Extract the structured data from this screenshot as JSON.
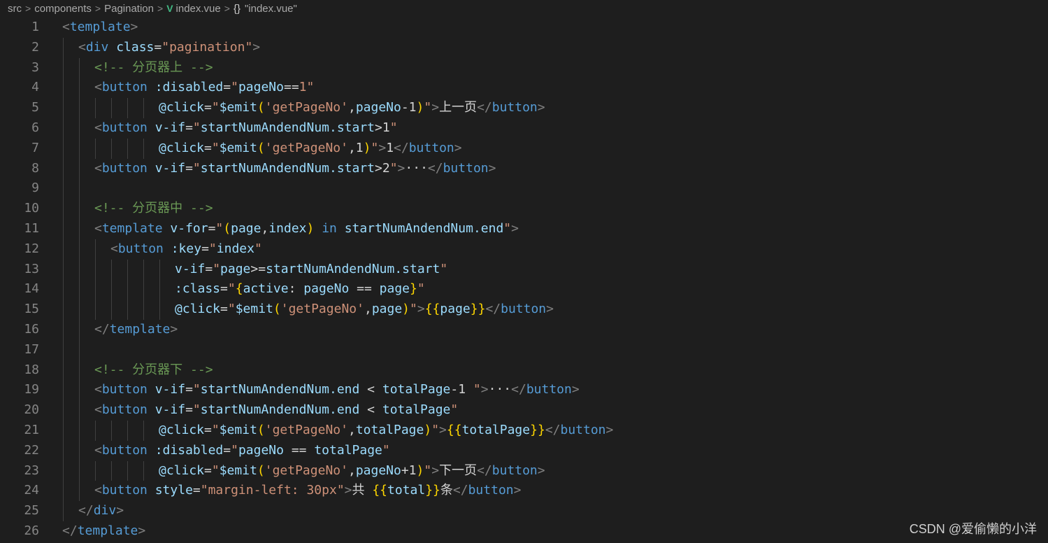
{
  "breadcrumb": {
    "items": [
      "src",
      "components",
      "Pagination",
      "index.vue",
      "\"index.vue\""
    ],
    "separator": ">",
    "braces": "{}"
  },
  "watermark": "CSDN @爱偷懒的小洋",
  "lines": [
    {
      "n": "1",
      "indent": 0,
      "guides": 0,
      "tokens": [
        [
          "punc",
          "<"
        ],
        [
          "tag",
          "template"
        ],
        [
          "punc",
          ">"
        ]
      ]
    },
    {
      "n": "2",
      "indent": 2,
      "guides": 1,
      "tokens": [
        [
          "punc",
          "<"
        ],
        [
          "tag",
          "div"
        ],
        [
          "text",
          " "
        ],
        [
          "attr",
          "class"
        ],
        [
          "text",
          "="
        ],
        [
          "str",
          "\"pagination\""
        ],
        [
          "punc",
          ">"
        ]
      ]
    },
    {
      "n": "3",
      "indent": 4,
      "guides": 2,
      "tokens": [
        [
          "com",
          "<!-- 分页器上 -->"
        ]
      ]
    },
    {
      "n": "4",
      "indent": 4,
      "guides": 2,
      "tokens": [
        [
          "punc",
          "<"
        ],
        [
          "tag",
          "button"
        ],
        [
          "text",
          " "
        ],
        [
          "attr",
          ":disabled"
        ],
        [
          "text",
          "="
        ],
        [
          "str",
          "\""
        ],
        [
          "attr",
          "pageNo"
        ],
        [
          "text",
          "=="
        ],
        [
          "str",
          "1\""
        ]
      ]
    },
    {
      "n": "5",
      "indent": 12,
      "guides": 6,
      "tokens": [
        [
          "attr",
          "@click"
        ],
        [
          "text",
          "="
        ],
        [
          "str",
          "\""
        ],
        [
          "attr",
          "$emit"
        ],
        [
          "paren",
          "("
        ],
        [
          "str",
          "'getPageNo'"
        ],
        [
          "text",
          ","
        ],
        [
          "attr",
          "pageNo"
        ],
        [
          "text",
          "-1"
        ],
        [
          "paren",
          ")"
        ],
        [
          "str",
          "\""
        ],
        [
          "punc",
          ">"
        ],
        [
          "text",
          "上一页"
        ],
        [
          "punc",
          "</"
        ],
        [
          "tag",
          "button"
        ],
        [
          "punc",
          ">"
        ]
      ]
    },
    {
      "n": "6",
      "indent": 4,
      "guides": 2,
      "tokens": [
        [
          "punc",
          "<"
        ],
        [
          "tag",
          "button"
        ],
        [
          "text",
          " "
        ],
        [
          "attr",
          "v-if"
        ],
        [
          "text",
          "="
        ],
        [
          "str",
          "\""
        ],
        [
          "attr",
          "startNumAndendNum.start"
        ],
        [
          "text",
          ">1"
        ],
        [
          "str",
          "\""
        ]
      ]
    },
    {
      "n": "7",
      "indent": 12,
      "guides": 6,
      "tokens": [
        [
          "attr",
          "@click"
        ],
        [
          "text",
          "="
        ],
        [
          "str",
          "\""
        ],
        [
          "attr",
          "$emit"
        ],
        [
          "paren",
          "("
        ],
        [
          "str",
          "'getPageNo'"
        ],
        [
          "text",
          ",1"
        ],
        [
          "paren",
          ")"
        ],
        [
          "str",
          "\""
        ],
        [
          "punc",
          ">"
        ],
        [
          "text",
          "1"
        ],
        [
          "punc",
          "</"
        ],
        [
          "tag",
          "button"
        ],
        [
          "punc",
          ">"
        ]
      ]
    },
    {
      "n": "8",
      "indent": 4,
      "guides": 2,
      "tokens": [
        [
          "punc",
          "<"
        ],
        [
          "tag",
          "button"
        ],
        [
          "text",
          " "
        ],
        [
          "attr",
          "v-if"
        ],
        [
          "text",
          "="
        ],
        [
          "str",
          "\""
        ],
        [
          "attr",
          "startNumAndendNum.start"
        ],
        [
          "text",
          ">2"
        ],
        [
          "str",
          "\""
        ],
        [
          "punc",
          ">"
        ],
        [
          "text",
          "···"
        ],
        [
          "punc",
          "</"
        ],
        [
          "tag",
          "button"
        ],
        [
          "punc",
          ">"
        ]
      ]
    },
    {
      "n": "9",
      "indent": 0,
      "guides": 2,
      "tokens": []
    },
    {
      "n": "10",
      "indent": 4,
      "guides": 2,
      "tokens": [
        [
          "com",
          "<!-- 分页器中 -->"
        ]
      ]
    },
    {
      "n": "11",
      "indent": 4,
      "guides": 2,
      "tokens": [
        [
          "punc",
          "<"
        ],
        [
          "tag",
          "template"
        ],
        [
          "text",
          " "
        ],
        [
          "attr",
          "v-for"
        ],
        [
          "text",
          "="
        ],
        [
          "str",
          "\""
        ],
        [
          "paren",
          "("
        ],
        [
          "attr",
          "page"
        ],
        [
          "text",
          ","
        ],
        [
          "attr",
          "index"
        ],
        [
          "paren",
          ")"
        ],
        [
          "text",
          " "
        ],
        [
          "kw",
          "in"
        ],
        [
          "text",
          " "
        ],
        [
          "attr",
          "startNumAndendNum.end"
        ],
        [
          "str",
          "\""
        ],
        [
          "punc",
          ">"
        ]
      ]
    },
    {
      "n": "12",
      "indent": 6,
      "guides": 3,
      "tokens": [
        [
          "punc",
          "<"
        ],
        [
          "tag",
          "button"
        ],
        [
          "text",
          " "
        ],
        [
          "attr",
          ":key"
        ],
        [
          "text",
          "="
        ],
        [
          "str",
          "\""
        ],
        [
          "attr",
          "index"
        ],
        [
          "str",
          "\""
        ]
      ]
    },
    {
      "n": "13",
      "indent": 14,
      "guides": 7,
      "tokens": [
        [
          "attr",
          "v-if"
        ],
        [
          "text",
          "="
        ],
        [
          "str",
          "\""
        ],
        [
          "attr",
          "page"
        ],
        [
          "text",
          ">="
        ],
        [
          "attr",
          "startNumAndendNum.start"
        ],
        [
          "str",
          "\""
        ]
      ]
    },
    {
      "n": "14",
      "indent": 14,
      "guides": 7,
      "tokens": [
        [
          "attr",
          ":class"
        ],
        [
          "text",
          "="
        ],
        [
          "str",
          "\""
        ],
        [
          "brace",
          "{"
        ],
        [
          "attr",
          "active"
        ],
        [
          "text",
          ": "
        ],
        [
          "attr",
          "pageNo"
        ],
        [
          "text",
          " == "
        ],
        [
          "attr",
          "page"
        ],
        [
          "brace",
          "}"
        ],
        [
          "str",
          "\""
        ]
      ]
    },
    {
      "n": "15",
      "indent": 14,
      "guides": 7,
      "tokens": [
        [
          "attr",
          "@click"
        ],
        [
          "text",
          "="
        ],
        [
          "str",
          "\""
        ],
        [
          "attr",
          "$emit"
        ],
        [
          "paren",
          "("
        ],
        [
          "str",
          "'getPageNo'"
        ],
        [
          "text",
          ","
        ],
        [
          "attr",
          "page"
        ],
        [
          "paren",
          ")"
        ],
        [
          "str",
          "\""
        ],
        [
          "punc",
          ">"
        ],
        [
          "brace",
          "{{"
        ],
        [
          "attr",
          "page"
        ],
        [
          "brace",
          "}}"
        ],
        [
          "punc",
          "</"
        ],
        [
          "tag",
          "button"
        ],
        [
          "punc",
          ">"
        ]
      ]
    },
    {
      "n": "16",
      "indent": 4,
      "guides": 2,
      "tokens": [
        [
          "punc",
          "</"
        ],
        [
          "tag",
          "template"
        ],
        [
          "punc",
          ">"
        ]
      ]
    },
    {
      "n": "17",
      "indent": 0,
      "guides": 2,
      "tokens": []
    },
    {
      "n": "18",
      "indent": 4,
      "guides": 2,
      "tokens": [
        [
          "com",
          "<!-- 分页器下 -->"
        ]
      ]
    },
    {
      "n": "19",
      "indent": 4,
      "guides": 2,
      "tokens": [
        [
          "punc",
          "<"
        ],
        [
          "tag",
          "button"
        ],
        [
          "text",
          " "
        ],
        [
          "attr",
          "v-if"
        ],
        [
          "text",
          "="
        ],
        [
          "str",
          "\""
        ],
        [
          "attr",
          "startNumAndendNum.end"
        ],
        [
          "text",
          " < "
        ],
        [
          "attr",
          "totalPage"
        ],
        [
          "text",
          "-1 "
        ],
        [
          "str",
          "\""
        ],
        [
          "punc",
          ">"
        ],
        [
          "text",
          "···"
        ],
        [
          "punc",
          "</"
        ],
        [
          "tag",
          "button"
        ],
        [
          "punc",
          ">"
        ]
      ]
    },
    {
      "n": "20",
      "indent": 4,
      "guides": 2,
      "tokens": [
        [
          "punc",
          "<"
        ],
        [
          "tag",
          "button"
        ],
        [
          "text",
          " "
        ],
        [
          "attr",
          "v-if"
        ],
        [
          "text",
          "="
        ],
        [
          "str",
          "\""
        ],
        [
          "attr",
          "startNumAndendNum.end"
        ],
        [
          "text",
          " < "
        ],
        [
          "attr",
          "totalPage"
        ],
        [
          "str",
          "\""
        ]
      ]
    },
    {
      "n": "21",
      "indent": 12,
      "guides": 6,
      "tokens": [
        [
          "attr",
          "@click"
        ],
        [
          "text",
          "="
        ],
        [
          "str",
          "\""
        ],
        [
          "attr",
          "$emit"
        ],
        [
          "paren",
          "("
        ],
        [
          "str",
          "'getPageNo'"
        ],
        [
          "text",
          ","
        ],
        [
          "attr",
          "totalPage"
        ],
        [
          "paren",
          ")"
        ],
        [
          "str",
          "\""
        ],
        [
          "punc",
          ">"
        ],
        [
          "brace",
          "{{"
        ],
        [
          "attr",
          "totalPage"
        ],
        [
          "brace",
          "}}"
        ],
        [
          "punc",
          "</"
        ],
        [
          "tag",
          "button"
        ],
        [
          "punc",
          ">"
        ]
      ]
    },
    {
      "n": "22",
      "indent": 4,
      "guides": 2,
      "tokens": [
        [
          "punc",
          "<"
        ],
        [
          "tag",
          "button"
        ],
        [
          "text",
          " "
        ],
        [
          "attr",
          ":disabled"
        ],
        [
          "text",
          "="
        ],
        [
          "str",
          "\""
        ],
        [
          "attr",
          "pageNo"
        ],
        [
          "text",
          " == "
        ],
        [
          "attr",
          "totalPage"
        ],
        [
          "str",
          "\""
        ]
      ]
    },
    {
      "n": "23",
      "indent": 12,
      "guides": 6,
      "tokens": [
        [
          "attr",
          "@click"
        ],
        [
          "text",
          "="
        ],
        [
          "str",
          "\""
        ],
        [
          "attr",
          "$emit"
        ],
        [
          "paren",
          "("
        ],
        [
          "str",
          "'getPageNo'"
        ],
        [
          "text",
          ","
        ],
        [
          "attr",
          "pageNo"
        ],
        [
          "text",
          "+1"
        ],
        [
          "paren",
          ")"
        ],
        [
          "str",
          "\""
        ],
        [
          "punc",
          ">"
        ],
        [
          "text",
          "下一页"
        ],
        [
          "punc",
          "</"
        ],
        [
          "tag",
          "button"
        ],
        [
          "punc",
          ">"
        ]
      ]
    },
    {
      "n": "24",
      "indent": 4,
      "guides": 2,
      "tokens": [
        [
          "punc",
          "<"
        ],
        [
          "tag",
          "button"
        ],
        [
          "text",
          " "
        ],
        [
          "attr",
          "style"
        ],
        [
          "text",
          "="
        ],
        [
          "str",
          "\"margin-left: 30px\""
        ],
        [
          "punc",
          ">"
        ],
        [
          "text",
          "共 "
        ],
        [
          "brace",
          "{{"
        ],
        [
          "attr",
          "total"
        ],
        [
          "brace",
          "}}"
        ],
        [
          "text",
          "条"
        ],
        [
          "punc",
          "</"
        ],
        [
          "tag",
          "button"
        ],
        [
          "punc",
          ">"
        ]
      ]
    },
    {
      "n": "25",
      "indent": 2,
      "guides": 1,
      "tokens": [
        [
          "punc",
          "</"
        ],
        [
          "tag",
          "div"
        ],
        [
          "punc",
          ">"
        ]
      ]
    },
    {
      "n": "26",
      "indent": 0,
      "guides": 0,
      "tokens": [
        [
          "punc",
          "</"
        ],
        [
          "tag",
          "template"
        ],
        [
          "punc",
          ">"
        ]
      ]
    }
  ]
}
